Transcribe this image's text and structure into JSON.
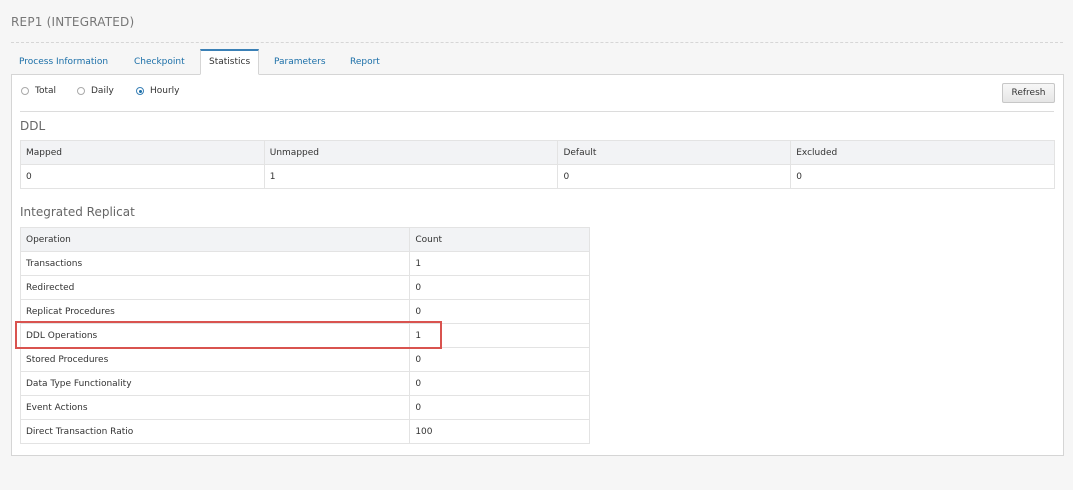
{
  "page": {
    "title": "REP1 (INTEGRATED)"
  },
  "tabs": [
    {
      "label": "Process Information",
      "active": false
    },
    {
      "label": "Checkpoint",
      "active": false
    },
    {
      "label": "Statistics",
      "active": true
    },
    {
      "label": "Parameters",
      "active": false
    },
    {
      "label": "Report",
      "active": false
    }
  ],
  "filters": {
    "options": [
      {
        "label": "Total",
        "selected": false
      },
      {
        "label": "Daily",
        "selected": false
      },
      {
        "label": "Hourly",
        "selected": true
      }
    ],
    "refresh_label": "Refresh"
  },
  "ddl": {
    "title": "DDL",
    "columns": [
      "Mapped",
      "Unmapped",
      "Default",
      "Excluded"
    ],
    "values": [
      "0",
      "1",
      "0",
      "0"
    ]
  },
  "integrated_replicat": {
    "title": "Integrated Replicat",
    "columns": [
      "Operation",
      "Count"
    ],
    "rows": [
      {
        "operation": "Transactions",
        "count": "1"
      },
      {
        "operation": "Redirected",
        "count": "0"
      },
      {
        "operation": "Replicat Procedures",
        "count": "0"
      },
      {
        "operation": "DDL Operations",
        "count": "1"
      },
      {
        "operation": "Stored Procedures",
        "count": "0"
      },
      {
        "operation": "Data Type Functionality",
        "count": "0"
      },
      {
        "operation": "Event Actions",
        "count": "0"
      },
      {
        "operation": "Direct Transaction Ratio",
        "count": "100"
      }
    ],
    "highlighted_row": "DDL Operations"
  },
  "colors": {
    "accent": "#1b6fa8",
    "highlight": "#d9534f"
  }
}
